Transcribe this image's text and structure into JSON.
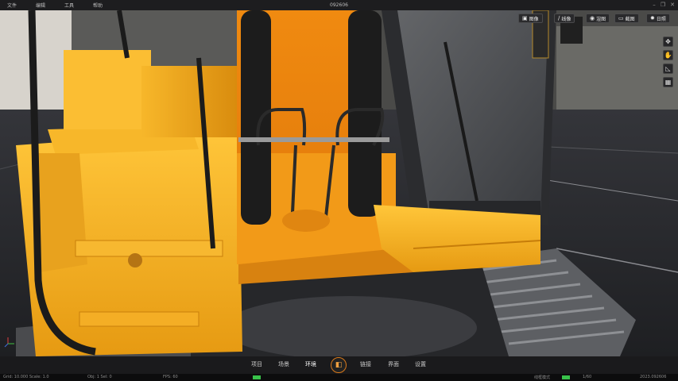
{
  "titlebar": {
    "menu": [
      "文件",
      "编辑",
      "工具",
      "帮助"
    ],
    "title": "092606"
  },
  "viewport_tools": {
    "top_buttons": [
      {
        "icon": "image-icon",
        "label": "图像"
      },
      {
        "icon": "line-icon",
        "label": "线像"
      },
      {
        "icon": "render-icon",
        "label": "渲图"
      },
      {
        "icon": "camera-icon",
        "label": "截图"
      },
      {
        "icon": "sun-icon",
        "label": "日照"
      }
    ],
    "side_buttons": [
      {
        "icon": "move-icon",
        "glyph": "✥"
      },
      {
        "icon": "pan-hand-icon",
        "glyph": "✋"
      },
      {
        "icon": "slope-icon",
        "glyph": "◺"
      },
      {
        "icon": "grid-icon",
        "glyph": "▦"
      }
    ]
  },
  "bottom_tabs": [
    "项目",
    "场景",
    "环境",
    "链接",
    "界面",
    "设置"
  ],
  "active_tab": "环境",
  "colors": {
    "accent": "#d9791a",
    "machine_yellow": "#f2a51c",
    "status_green": "#38c24a"
  },
  "statusbar": {
    "left": "Grid: 10.000  Scale: 1.0",
    "mid1": "Obj: 1  Sel: 0",
    "mid2": "FPS: 60",
    "mode": "线框模式",
    "right": "1/60",
    "right2": "2023.092606"
  }
}
